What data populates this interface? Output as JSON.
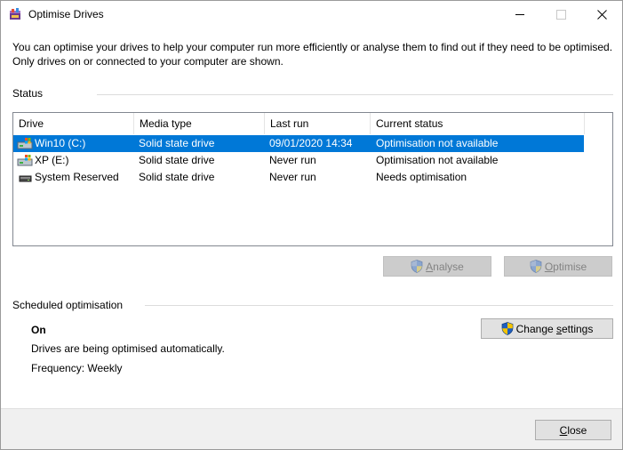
{
  "window": {
    "title": "Optimise Drives"
  },
  "description": "You can optimise your drives to help your computer run more efficiently or analyse them to find out if they need to be optimised. Only drives on or connected to your computer are shown.",
  "status": {
    "heading": "Status",
    "columns": [
      "Drive",
      "Media type",
      "Last run",
      "Current status"
    ],
    "drives": [
      {
        "name": "Win10 (C:)",
        "media": "Solid state drive",
        "last_run": "09/01/2020 14:34",
        "status": "Optimisation not available",
        "icon": "windows-drive-icon",
        "selected": true
      },
      {
        "name": "XP (E:)",
        "media": "Solid state drive",
        "last_run": "Never run",
        "status": "Optimisation not available",
        "icon": "windows-drive-icon",
        "selected": false
      },
      {
        "name": "System Reserved",
        "media": "Solid state drive",
        "last_run": "Never run",
        "status": "Needs optimisation",
        "icon": "drive-icon",
        "selected": false
      }
    ],
    "analyse_label_first": "A",
    "analyse_label_rest": "nalyse",
    "optimise_label_first": "O",
    "optimise_label_rest": "ptimise"
  },
  "scheduled": {
    "heading": "Scheduled optimisation",
    "state": "On",
    "message": "Drives are being optimised automatically.",
    "frequency": "Frequency: Weekly",
    "change_label_pre": "Change ",
    "change_label_mnemonic": "s",
    "change_label_post": "ettings"
  },
  "footer": {
    "close_label_first": "C",
    "close_label_rest": "lose"
  },
  "colors": {
    "selection": "#0078d7",
    "shield_blue": "#1f5fbf",
    "shield_yellow": "#f5c400"
  }
}
